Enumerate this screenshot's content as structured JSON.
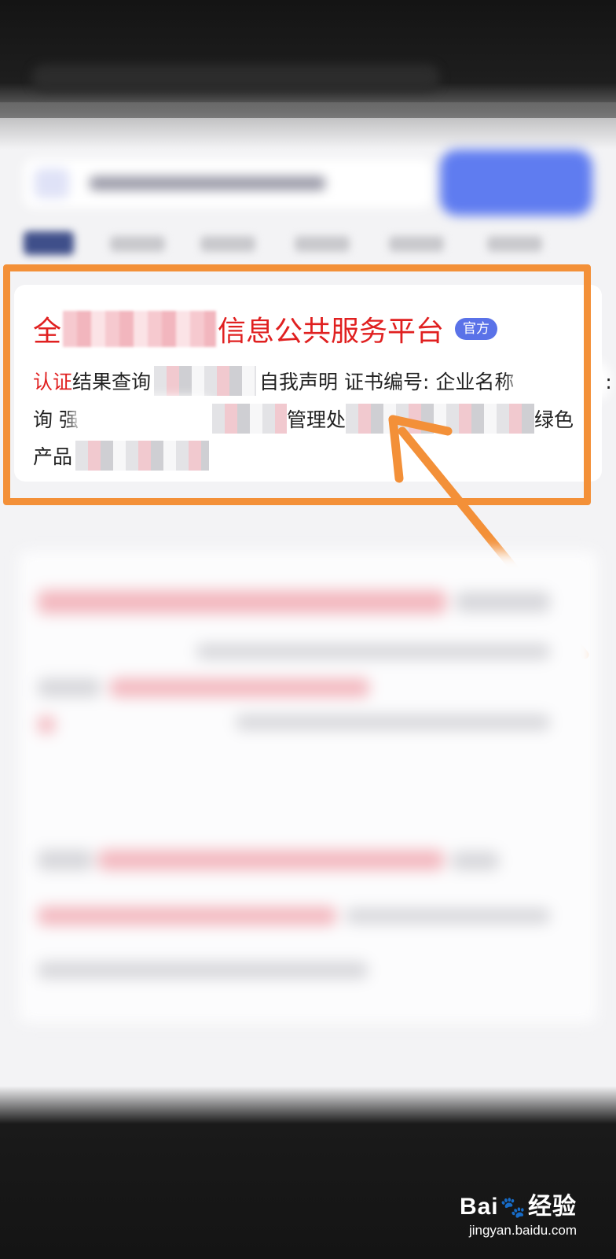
{
  "result_card": {
    "title_prefix": "全",
    "title_suffix": "信息公共服务平台",
    "badge": "官方",
    "line1": {
      "hl": "认证",
      "text_a": "结果查询",
      "text_b": "自我声明 证书编号: 企业名称",
      "text_c": ": 查"
    },
    "line2": {
      "text_a": "询 强",
      "text_b": "管理处",
      "text_c": "绿色"
    },
    "line3": {
      "text_a": "产品"
    }
  },
  "watermark": {
    "brand_a": "Bai",
    "brand_b": "经验",
    "site": "jingyan.baidu.com"
  },
  "colors": {
    "highlight_frame": "#f39038",
    "title_red": "#e02020",
    "badge_blue": "#5a72e8",
    "search_button": "#5f7cf0"
  },
  "icons": {
    "annotation": "arrow-annotation-icon",
    "watermark": "paw-icon"
  }
}
